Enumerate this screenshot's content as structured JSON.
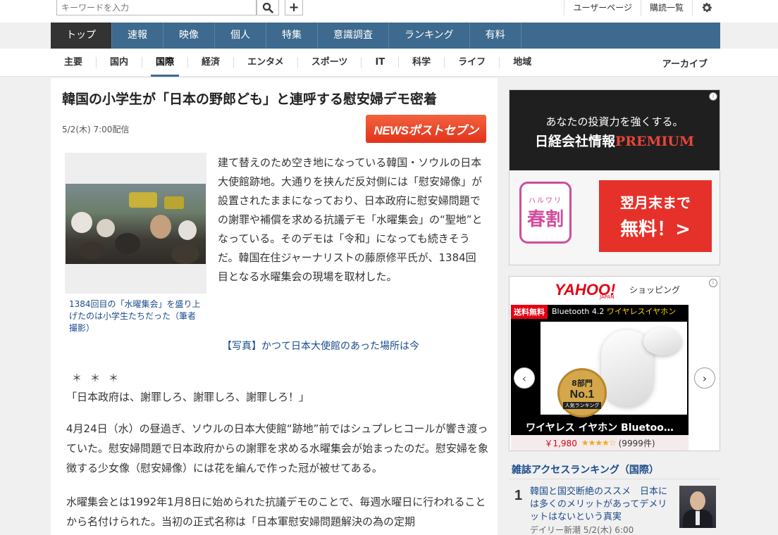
{
  "search": {
    "placeholder": "キーワードを入力"
  },
  "top_links": [
    "ユーザーページ",
    "購読一覧"
  ],
  "main_nav": [
    "トップ",
    "速報",
    "映像",
    "個人",
    "特集",
    "意識調査",
    "ランキング",
    "有料"
  ],
  "sub_nav": [
    "主要",
    "国内",
    "国際",
    "経済",
    "エンタメ",
    "スポーツ",
    "IT",
    "科学",
    "ライフ",
    "地域"
  ],
  "sub_nav_archive": "アーカイブ",
  "article": {
    "title": "韓国の小学生が「日本の野郎ども」と連呼する慰安婦デモ密着",
    "date": "5/2(木) 7:00配信",
    "source_logo": "NEWSポストセブン",
    "caption": "1384回目の「水曜集会」を盛り上げたのは小学生たちだった（筆者撮影）",
    "lead": "建て替えのため空き地になっている韓国・ソウルの日本大使館跡地。大通りを挟んだ反対側には「慰安婦像」が設置されたままになっており、日本政府に慰安婦問題での謝罪や補償を求める抗議デモ「水曜集会」の“聖地”となっている。そのデモは「令和」になっても続きそうだ。韓国在住ジャーナリストの藤原修平氏が、1384回目となる水曜集会の現場を取材した。",
    "photo_link": "【写真】かつて日本大使館のあった場所は今",
    "stars": "＊＊＊",
    "quote": "「日本政府は、謝罪しろ、謝罪しろ、謝罪しろ！」",
    "para1": "4月24日（水）の昼過ぎ、ソウルの日本大使館“跡地”前ではシュプレヒコールが響き渡っていた。慰安婦問題で日本政府からの謝罪を求める水曜集会が始まったのだ。慰安婦を象徴する少女像（慰安婦像）には花を編んで作った冠が被せてある。",
    "para2": "水曜集会とは1992年1月8日に始められた抗議デモのことで、毎週水曜日に行われることから名付けられた。当初の正式名称は「日本軍慰安婦問題解決の為の定期"
  },
  "ad1": {
    "line1": "あなたの投資力を強くする。",
    "line2_main": "日経会社情報",
    "line2_accent": "PREMIUM",
    "badge_small": "ハルワリ",
    "badge_big": "春割",
    "cta1": "翌月末まで",
    "cta2": "無料！>"
  },
  "ad2": {
    "brand": "YAHOO!",
    "brand_sub": "JAPAN",
    "brand_shop": "ショッピング",
    "badge": "送料無料",
    "head_main": "Bluetooth 4.2",
    "head_accent": "ワイヤレスイヤホン",
    "medal_a": "8部門",
    "medal_b": "No.1",
    "medal_c": "人気ランキング",
    "name": "ワイヤレス イヤホン Bluetoo…",
    "price": "￥1,980",
    "rating_stars": "★★★★☆",
    "rating": 4,
    "count": "(9999件)"
  },
  "ranking": {
    "title": "雑誌アクセスランキング（国際）",
    "items": [
      {
        "num": "1",
        "text": "韓国と国交断絶のススメ　日本には多くのメリットがあってデメリットはないという真実",
        "meta": "デイリー新潮 5/2(木) 6:00"
      }
    ]
  },
  "colors": {
    "nav_bg": "#3d6a8e",
    "link": "#1a4b8c",
    "accent_red": "#e5312a"
  }
}
